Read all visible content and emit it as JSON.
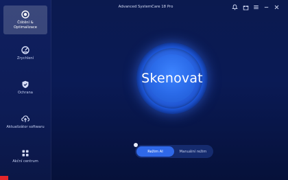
{
  "window": {
    "title": "Advanced SystemCare 18 Pro"
  },
  "titlebar_icons": [
    {
      "name": "bell-icon"
    },
    {
      "name": "gift-icon"
    },
    {
      "name": "menu-icon"
    },
    {
      "name": "minimize-icon"
    },
    {
      "name": "close-icon"
    }
  ],
  "sidebar": {
    "items": [
      {
        "label": "Čištění &\nOptimalizace",
        "icon": "broom-icon",
        "active": true
      },
      {
        "label": "Zrychlení",
        "icon": "speedometer-icon",
        "active": false
      },
      {
        "label": "Ochrana",
        "icon": "shield-icon",
        "active": false
      },
      {
        "label": "Aktualizátor softwaru",
        "icon": "cloud-upload-icon",
        "active": false
      },
      {
        "label": "Akční centrum",
        "icon": "grid-icon",
        "active": false
      }
    ]
  },
  "main": {
    "scan_label": "Skenovat",
    "modes": [
      {
        "label": "Režim AI",
        "active": true
      },
      {
        "label": "Manuální režim",
        "active": false
      }
    ]
  },
  "colors": {
    "accent": "#2f68e8",
    "sidebar_bg": "#0d1c56",
    "main_bg": "#0a1a55",
    "brand_red": "#e4262a"
  }
}
